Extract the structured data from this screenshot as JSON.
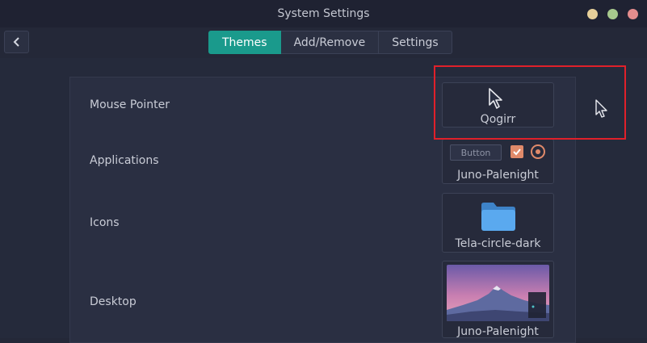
{
  "window": {
    "title": "System Settings"
  },
  "tabs": [
    {
      "label": "Themes",
      "active": true
    },
    {
      "label": "Add/Remove",
      "active": false
    },
    {
      "label": "Settings",
      "active": false
    }
  ],
  "rows": [
    {
      "label": "Mouse Pointer",
      "theme": "Qogirr"
    },
    {
      "label": "Applications",
      "theme": "Juno-Palenight",
      "preview_button": "Button"
    },
    {
      "label": "Icons",
      "theme": "Tela-circle-dark"
    },
    {
      "label": "Desktop",
      "theme": "Juno-Palenight"
    }
  ],
  "colors": {
    "accent": "#1a9a8c",
    "highlight": "#e0202a",
    "check": "#e08a6a",
    "folder": "#5aa9ef"
  }
}
